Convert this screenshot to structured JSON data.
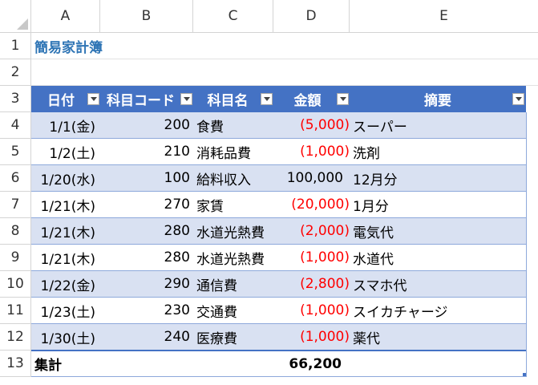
{
  "columns": [
    "A",
    "B",
    "C",
    "D",
    "E"
  ],
  "rows": [
    "1",
    "2",
    "3",
    "4",
    "5",
    "6",
    "7",
    "8",
    "9",
    "10",
    "11",
    "12",
    "13"
  ],
  "sheet_title": "簡易家計簿",
  "table_headers": {
    "date": "日付",
    "code": "科目コード",
    "name": "科目名",
    "amount": "金額",
    "memo": "摘要"
  },
  "entries": [
    {
      "date": "1/1(金)",
      "code": "200",
      "name": "食費",
      "amount": "(5,000)",
      "negative": true,
      "memo": "スーパー"
    },
    {
      "date": "1/2(土)",
      "code": "210",
      "name": "消耗品費",
      "amount": "(1,000)",
      "negative": true,
      "memo": "洗剤"
    },
    {
      "date": "1/20(水)",
      "code": "100",
      "name": "給料収入",
      "amount": "100,000",
      "negative": false,
      "memo": "12月分"
    },
    {
      "date": "1/21(木)",
      "code": "270",
      "name": "家賃",
      "amount": "(20,000)",
      "negative": true,
      "memo": "1月分"
    },
    {
      "date": "1/21(木)",
      "code": "280",
      "name": "水道光熱費",
      "amount": "(2,000)",
      "negative": true,
      "memo": "電気代"
    },
    {
      "date": "1/21(木)",
      "code": "280",
      "name": "水道光熱費",
      "amount": "(1,000)",
      "negative": true,
      "memo": "水道代"
    },
    {
      "date": "1/22(金)",
      "code": "290",
      "name": "通信費",
      "amount": "(2,800)",
      "negative": true,
      "memo": "スマホ代"
    },
    {
      "date": "1/23(土)",
      "code": "230",
      "name": "交通費",
      "amount": "(1,000)",
      "negative": true,
      "memo": "スイカチャージ"
    },
    {
      "date": "1/30(土)",
      "code": "240",
      "name": "医療費",
      "amount": "(1,000)",
      "negative": true,
      "memo": "薬代"
    }
  ],
  "total": {
    "label": "集計",
    "amount": "66,200"
  },
  "colors": {
    "header_blue": "#4472c4",
    "band_blue": "#d9e1f2",
    "title_blue": "#2f75b5",
    "negative_red": "#ff0000"
  }
}
